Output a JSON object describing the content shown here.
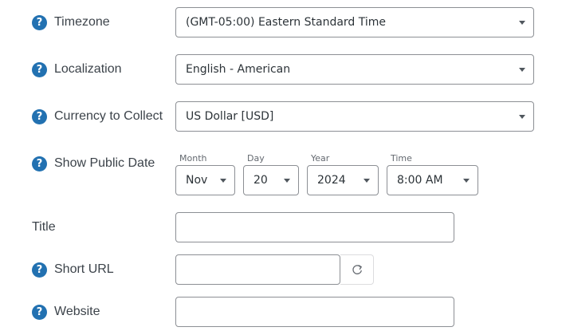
{
  "help_icon_glyph": "?",
  "timezone": {
    "label": "Timezone",
    "value": "(GMT-05:00) Eastern Standard Time"
  },
  "localization": {
    "label": "Localization",
    "value": "English - American"
  },
  "currency": {
    "label": "Currency to Collect",
    "value": "US Dollar [USD]"
  },
  "public_date": {
    "label": "Show Public Date",
    "month": {
      "label": "Month",
      "value": "Nov"
    },
    "day": {
      "label": "Day",
      "value": "20"
    },
    "year": {
      "label": "Year",
      "value": "2024"
    },
    "time": {
      "label": "Time",
      "value": "8:00 AM"
    }
  },
  "title": {
    "label": "Title",
    "value": ""
  },
  "short_url": {
    "label": "Short URL",
    "value": "",
    "refresh_icon": "refresh-icon"
  },
  "website": {
    "label": "Website",
    "value": ""
  },
  "colors": {
    "help_icon": "#2271b1",
    "label_text": "#3c434a",
    "input_border": "#8c8f94"
  }
}
